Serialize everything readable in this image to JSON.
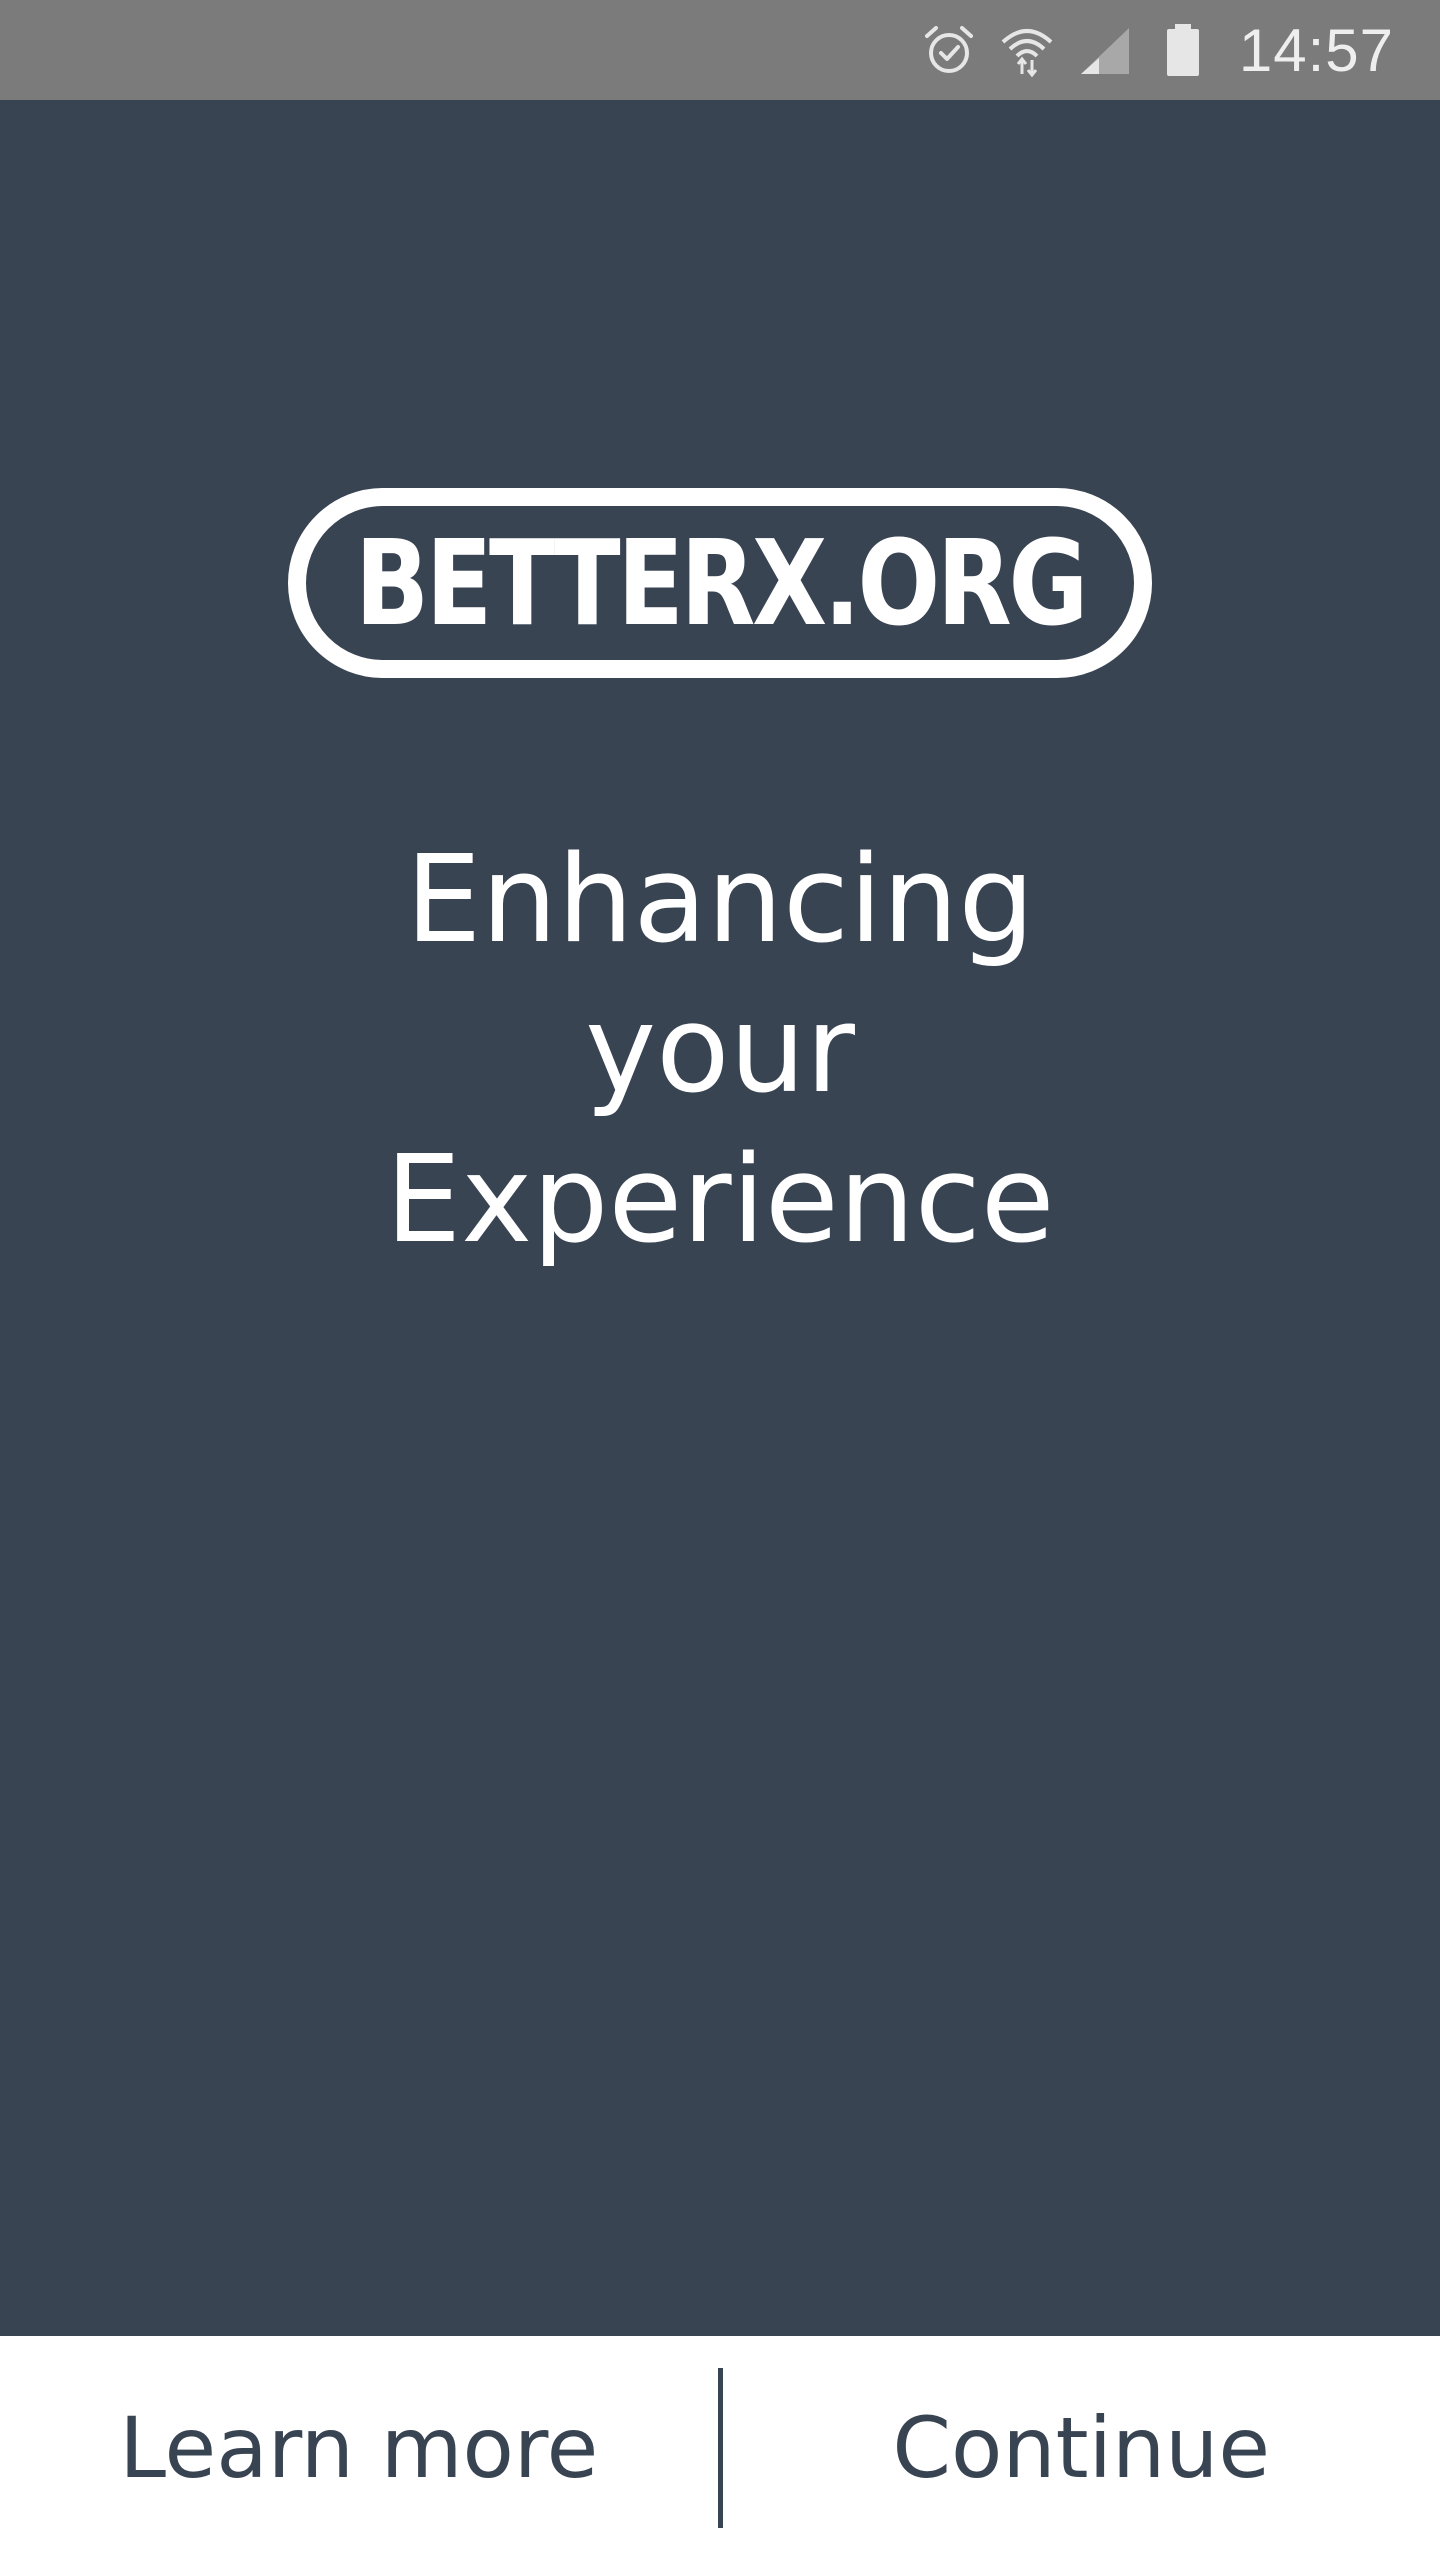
{
  "status_bar": {
    "time": "14:57",
    "icons": [
      "alarm-icon",
      "wifi-icon",
      "signal-icon",
      "battery-icon"
    ]
  },
  "logo": {
    "text": "BETTERX.ORG"
  },
  "headline": {
    "lines": [
      "Enhancing",
      "your",
      "Experience"
    ]
  },
  "actions": {
    "learn_more_label": "Learn more",
    "continue_label": "Continue"
  },
  "colors": {
    "background": "#394453",
    "status_bar": "#7b7b7b",
    "bottom_bar": "#ffffff",
    "text_light": "#ffffff",
    "text_dark": "#394453"
  }
}
